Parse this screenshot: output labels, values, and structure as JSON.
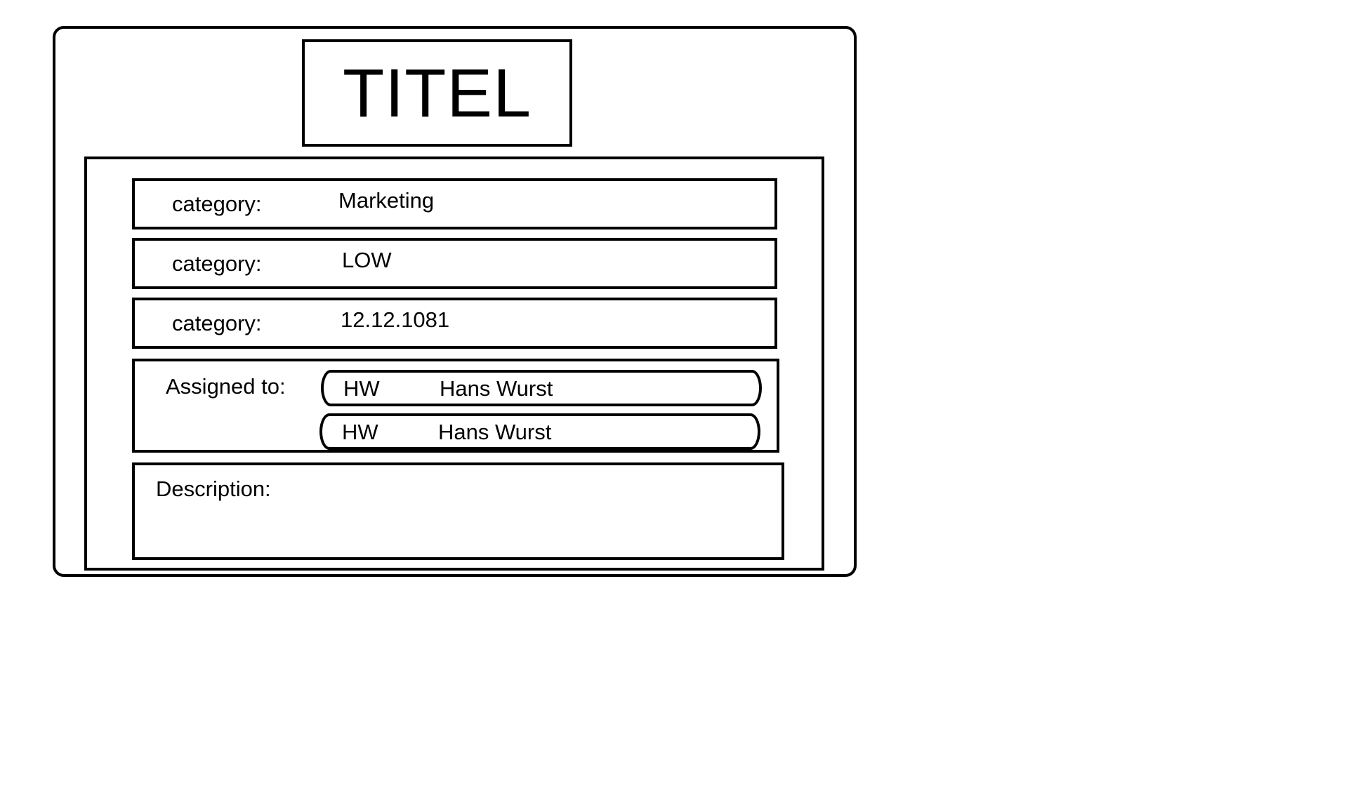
{
  "title": "TITEL",
  "fields": [
    {
      "label": "category:",
      "value": "Marketing"
    },
    {
      "label": "category:",
      "value": "LOW"
    },
    {
      "label": "category:",
      "value": "12.12.1081"
    }
  ],
  "assigned": {
    "label": "Assigned to:",
    "assignees": [
      {
        "initials": "HW",
        "name": "Hans Wurst"
      },
      {
        "initials": "HW",
        "name": "Hans Wurst"
      }
    ]
  },
  "description": {
    "label": "Description:"
  }
}
